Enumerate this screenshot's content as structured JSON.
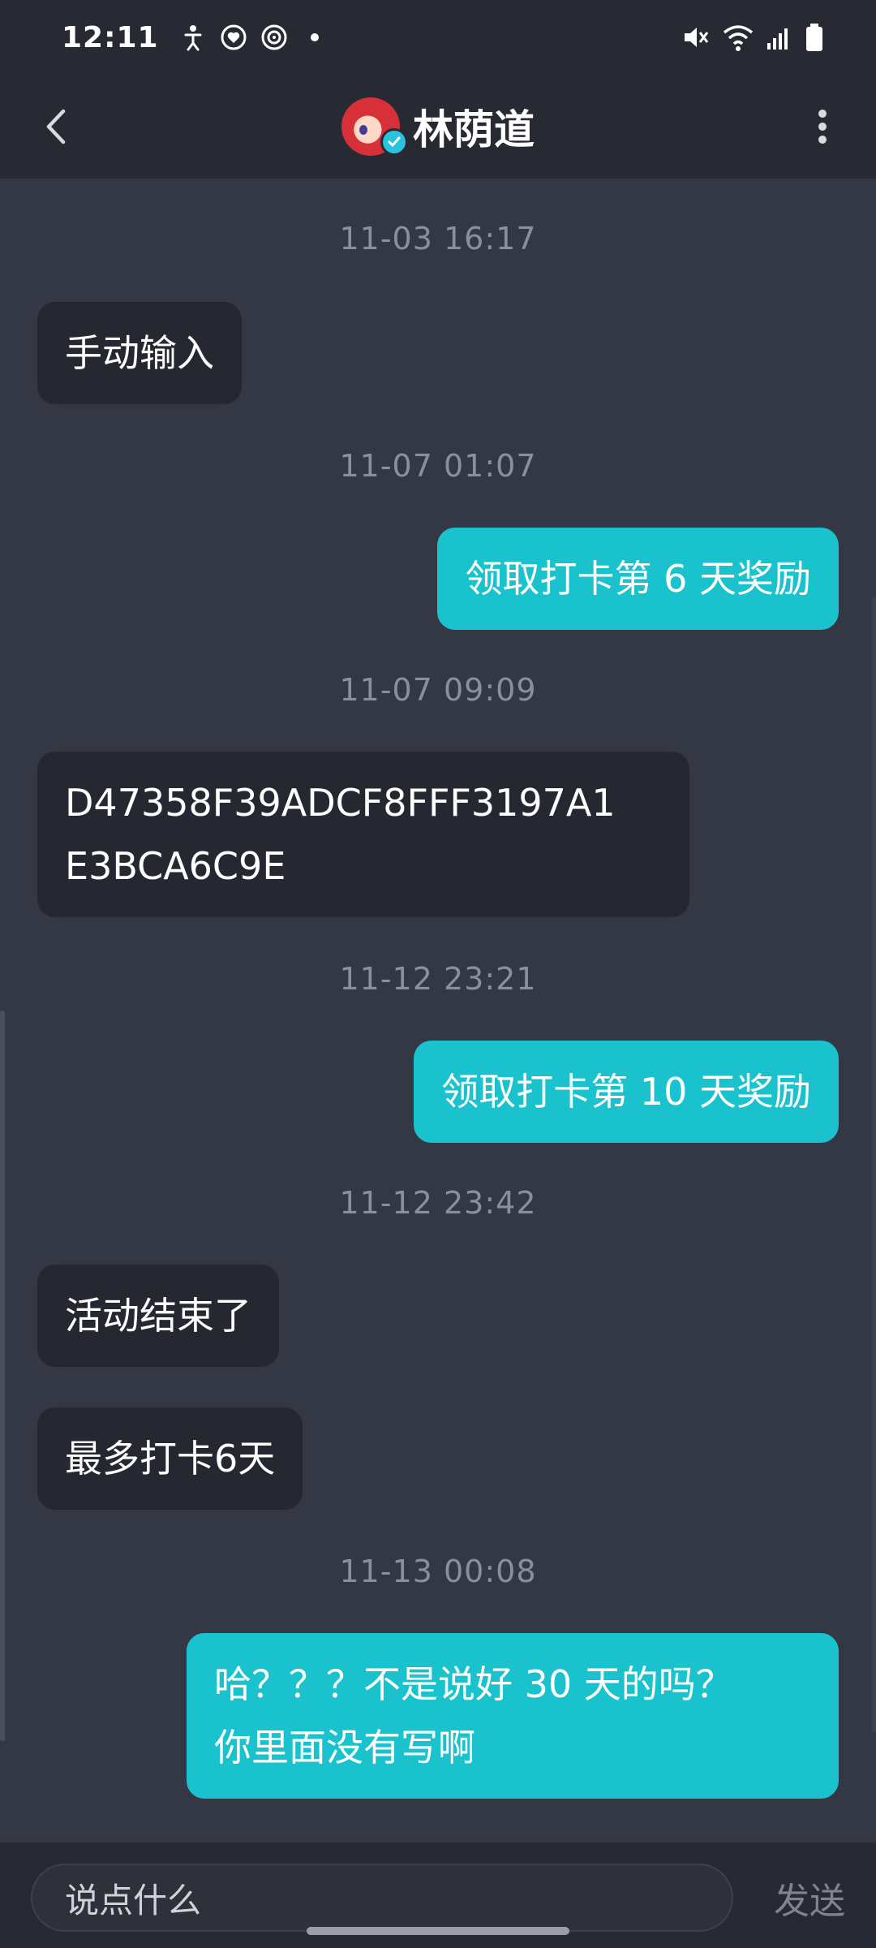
{
  "status_bar": {
    "time": "12:11",
    "left_icons": [
      "accessibility-icon",
      "heart-app-icon",
      "target-app-icon",
      "dot-icon"
    ],
    "right_icons": [
      "mute-icon",
      "wifi-icon",
      "signal-icon",
      "battery-icon"
    ]
  },
  "header": {
    "contact_name": "林荫道",
    "back_icon": "chevron-left-icon",
    "more_icon": "more-vertical-icon"
  },
  "messages": [
    {
      "type": "timestamp",
      "text": "11-03 16:17"
    },
    {
      "type": "incoming",
      "text": "手动输入"
    },
    {
      "type": "timestamp",
      "text": "11-07 01:07"
    },
    {
      "type": "outgoing",
      "text": "领取打卡第 6 天奖励"
    },
    {
      "type": "timestamp",
      "text": "11-07 09:09"
    },
    {
      "type": "incoming",
      "line1": "D47358F39ADCF8FFF3197A1",
      "line2": "E3BCA6C9E"
    },
    {
      "type": "timestamp",
      "text": "11-12 23:21"
    },
    {
      "type": "outgoing",
      "text": "领取打卡第 10 天奖励"
    },
    {
      "type": "timestamp",
      "text": "11-12 23:42"
    },
    {
      "type": "incoming",
      "text": "活动结束了"
    },
    {
      "type": "incoming",
      "text": "最多打卡6天"
    },
    {
      "type": "timestamp",
      "text": "11-13 00:08"
    },
    {
      "type": "outgoing",
      "line1": "哈？？？不是说好 30 天的吗？",
      "line2": "你里面没有写啊"
    }
  ],
  "input": {
    "placeholder": "说点什么",
    "send_label": "发送"
  },
  "colors": {
    "background": "#343845",
    "bar": "#272a33",
    "incoming_bubble": "#252831",
    "outgoing_bubble": "#19c2cd",
    "timestamp": "#8a8f9c"
  }
}
